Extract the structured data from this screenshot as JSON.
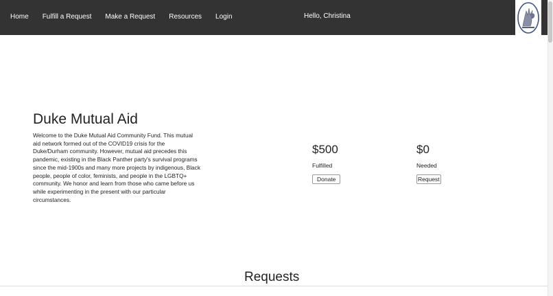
{
  "nav": {
    "links": [
      "Home",
      "Fulfill a Request",
      "Make a Request",
      "Resources",
      "Login"
    ],
    "greeting": "Hello, Christina",
    "logo_icon": "raised-fist-logo-icon"
  },
  "hero": {
    "title": "Duke Mutual Aid",
    "description": "Welcome to the Duke Mutual Aid Community Fund. This mutual aid network formed out of the COVID19 crisis for the Duke/Durham community. However, mutual aid precedes this pandemic, existing in the Black Panther party's survival programs since the mid-1900s and many more projects by indigenous, Black people, people of color, feminists, and people in the LGBTQ+ community. We honor and learn from those who came before us while experimenting in the present with our particular circumstances."
  },
  "stats": {
    "fulfilled": {
      "amount": "$500",
      "label": "Fulfilled",
      "button": "Donate"
    },
    "needed": {
      "amount": "$0",
      "label": "Needed",
      "button": "Request"
    }
  },
  "requests": {
    "title": "Requests"
  },
  "colors": {
    "navbar_bg": "#333333",
    "nav_text": "#ffffff",
    "logo_ring": "#3a4f8f",
    "body_text": "#222222"
  }
}
